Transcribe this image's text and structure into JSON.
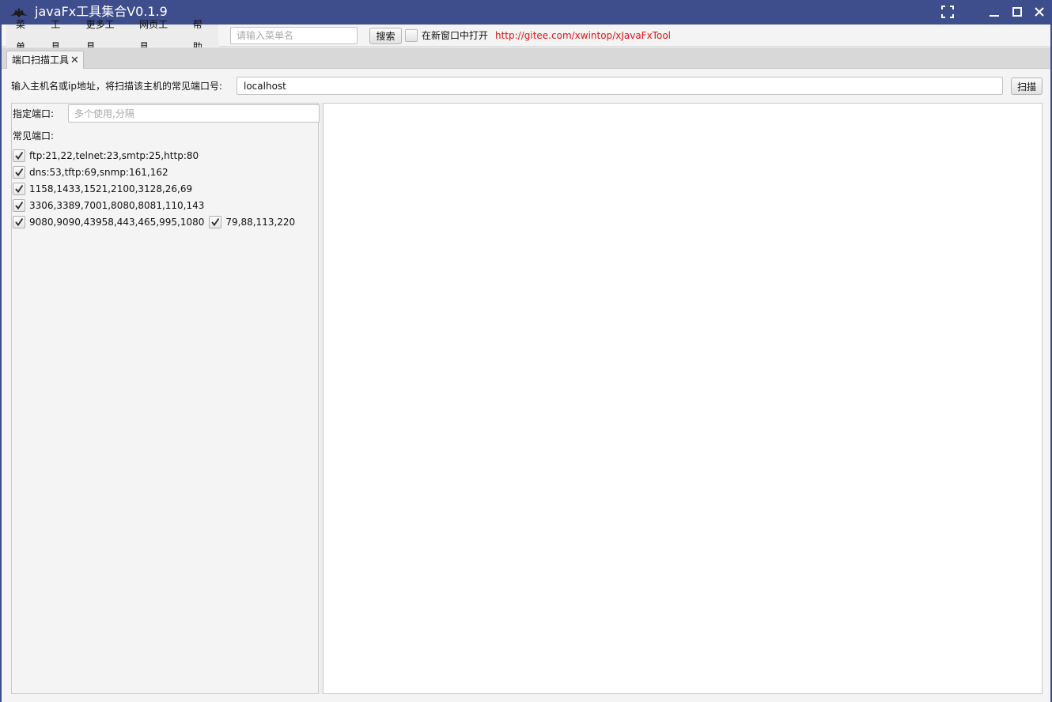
{
  "window": {
    "title": "javaFx工具集合V0.1.9",
    "icon": "app-bird-icon",
    "controls": [
      "fullscreen-icon",
      "minimize-icon",
      "maximize-icon",
      "close-icon"
    ]
  },
  "menubar": {
    "menus": [
      "菜单",
      "工具",
      "更多工具",
      "网页工具",
      "帮助"
    ],
    "search_placeholder": "请输入菜单名",
    "search_button": "搜索",
    "open_new_window_label": "在新窗口中打开",
    "open_new_window_checked": false,
    "link_text": "http://gitee.com/xwintop/xJavaFxTool"
  },
  "tabs": [
    {
      "label": "端口扫描工具",
      "close": "✕",
      "active": true
    }
  ],
  "scanner": {
    "host_label": "输入主机名或ip地址，将扫描该主机的常见端口号:",
    "host_value": "localhost",
    "scan_button": "扫描",
    "port_label": "指定端口:",
    "port_placeholder": "多个使用,分隔",
    "common_ports_label": "常见端口:",
    "port_groups": [
      {
        "label": "ftp:21,22,telnet:23,smtp:25,http:80",
        "checked": true
      },
      {
        "label": "dns:53,tftp:69,snmp:161,162",
        "checked": true
      },
      {
        "label": "1158,1433,1521,2100,3128,26,69",
        "checked": true
      },
      {
        "label": "3306,3389,7001,8080,8081,110,143",
        "checked": true
      },
      {
        "label": "9080,9090,43958,443,465,995,1080",
        "checked": true
      },
      {
        "label": "79,88,113,220",
        "checked": true
      }
    ],
    "result_text": ""
  },
  "colors": {
    "titlebar": "#3e4e8c",
    "link": "#e01515",
    "panel_bg": "#f4f4f4"
  }
}
